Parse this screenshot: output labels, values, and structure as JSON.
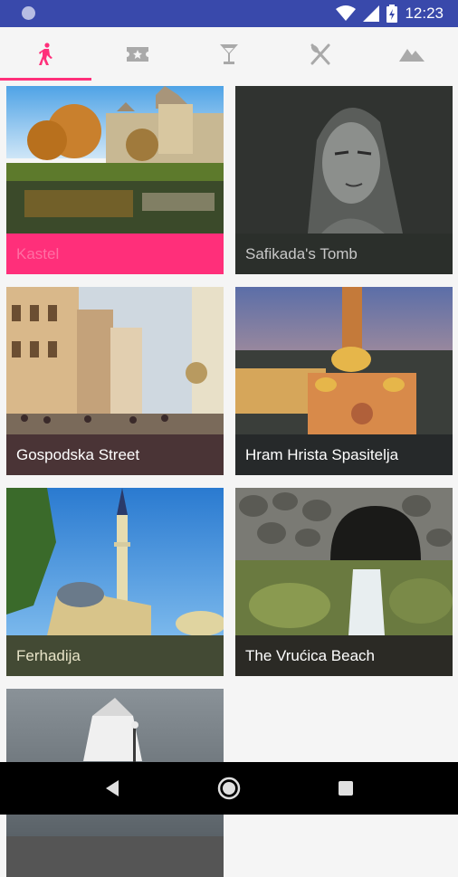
{
  "status_bar": {
    "time": "12:23",
    "icons": [
      "notification-dot-icon",
      "wifi-icon",
      "signal-icon",
      "battery-icon"
    ]
  },
  "tabs": [
    {
      "icon": "walking-person-icon",
      "active": true
    },
    {
      "icon": "ticket-icon",
      "active": false
    },
    {
      "icon": "cocktail-icon",
      "active": false
    },
    {
      "icon": "fork-knife-icon",
      "active": false
    },
    {
      "icon": "mountains-icon",
      "active": false
    }
  ],
  "colors": {
    "status_bar": "#3949ab",
    "accent": "#ff2f7a",
    "tab_inactive": "#a9a9a9"
  },
  "cards": [
    {
      "title": "Kastel",
      "label_color": "#ff2f7a",
      "text_color": "#ff6fa3"
    },
    {
      "title": "Safikada's Tomb",
      "label_color": "#2b2f2b",
      "text_color": "#c8c8c8"
    },
    {
      "title": "Gospodska Street",
      "label_color": "#4a3436",
      "text_color": "#ffffff"
    },
    {
      "title": "Hram Hrista Spasitelja",
      "label_color": "#26292a",
      "text_color": "#ffffff"
    },
    {
      "title": "Ferhadija",
      "label_color": "#434a34",
      "text_color": "#e8e4c8"
    },
    {
      "title": "The Vrućica Beach",
      "label_color": "#2b2a25",
      "text_color": "#ffffff"
    },
    {
      "title": "",
      "label_color": "#555555",
      "text_color": "#ffffff"
    }
  ],
  "nav_bar": [
    "back-icon",
    "home-icon",
    "recents-icon"
  ]
}
